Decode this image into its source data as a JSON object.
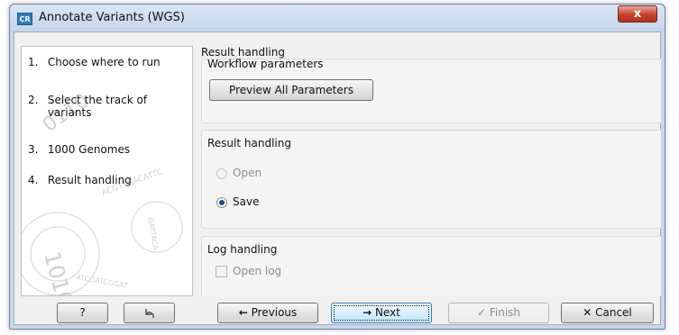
{
  "window": {
    "title": "Annotate Variants (WGS)",
    "app_icon_text": "CR",
    "close_glyph": "x"
  },
  "steps": [
    {
      "number": "1.",
      "label": "Choose where to run"
    },
    {
      "number": "2.",
      "label_line1": "Select the track of",
      "label_line2": "variants"
    },
    {
      "number": "3.",
      "label": "1000 Genomes"
    },
    {
      "number": "4.",
      "label": "Result handling"
    }
  ],
  "main": {
    "section_title": "Result handling",
    "workflow_parameters": {
      "title": "Workflow parameters",
      "preview_button": "Preview All Parameters"
    },
    "result_handling": {
      "title": "Result handling",
      "options": [
        {
          "label": "Open",
          "selected": false,
          "enabled": false
        },
        {
          "label": "Save",
          "selected": true,
          "enabled": true
        }
      ]
    },
    "log_handling": {
      "title": "Log handling",
      "open_log_label": "Open log",
      "open_log_checked": false,
      "enabled": false
    }
  },
  "footer": {
    "help_label": "?",
    "reset_icon": "undo-arrow-icon",
    "previous_label": "Previous",
    "next_label": "Next",
    "finish_label": "Finish",
    "cancel_label": "Cancel"
  },
  "colors": {
    "title_bar": "#c9d7ea",
    "close_button": "#c7412b",
    "focused_button": "#bee6fd",
    "radio_selected": "#1c5180"
  }
}
